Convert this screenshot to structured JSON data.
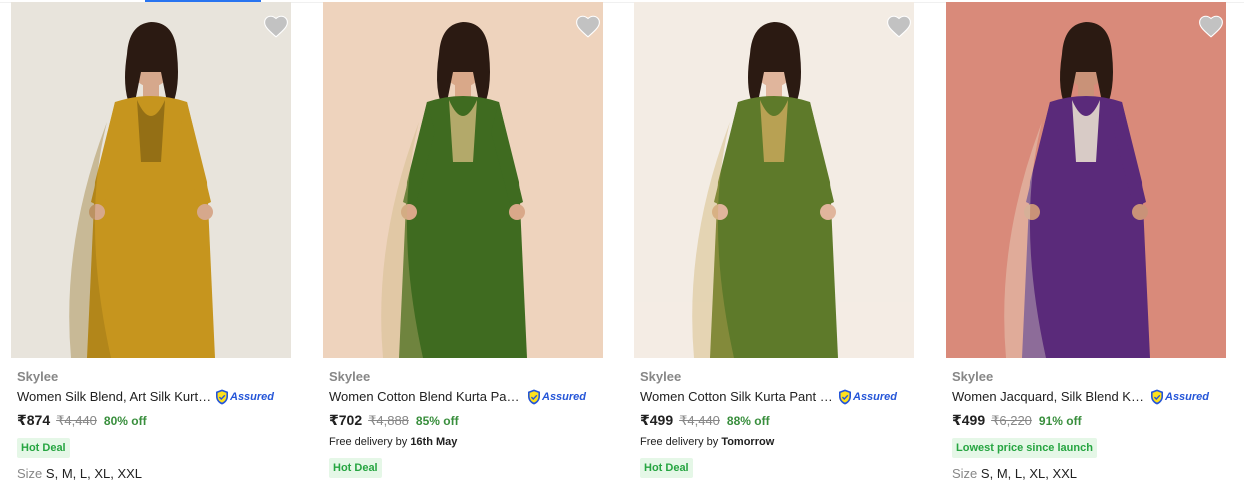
{
  "products": [
    {
      "brand": "Skylee",
      "title": "Women Silk Blend, Art Silk Kurta ...",
      "assured": "Assured",
      "price": "₹874",
      "mrp": "₹4,440",
      "discount": "80% off",
      "delivery_prefix": "",
      "delivery_date": "",
      "badge": "Hot Deal",
      "size_label": "Size",
      "sizes": "S, M, L, XL, XXL",
      "palette": {
        "bg": "#e8e4dc",
        "garment": "#c6951e",
        "accent": "#8b6914",
        "skin": "#d6a88c"
      }
    },
    {
      "brand": "Skylee",
      "title": "Women Cotton Blend Kurta Pant ...",
      "assured": "Assured",
      "price": "₹702",
      "mrp": "₹4,888",
      "discount": "85% off",
      "delivery_prefix": "Free delivery by ",
      "delivery_date": "16th May",
      "badge": "Hot Deal",
      "size_label": "",
      "sizes": "",
      "palette": {
        "bg": "#eed3bd",
        "garment": "#3f6b20",
        "accent": "#c8b478",
        "skin": "#d9a889"
      }
    },
    {
      "brand": "Skylee",
      "title": "Women Cotton Silk Kurta Pant D...",
      "assured": "Assured",
      "price": "₹499",
      "mrp": "₹4,440",
      "discount": "88% off",
      "delivery_prefix": "Free delivery by ",
      "delivery_date": "Tomorrow",
      "badge": "Hot Deal",
      "size_label": "",
      "sizes": "",
      "palette": {
        "bg": "#f3ece4",
        "garment": "#5e7a2a",
        "accent": "#c8a85a",
        "skin": "#e0b59c"
      }
    },
    {
      "brand": "Skylee",
      "title": "Women Jacquard, Silk Blend Kur...",
      "assured": "Assured",
      "price": "₹499",
      "mrp": "₹6,220",
      "discount": "91% off",
      "delivery_prefix": "",
      "delivery_date": "",
      "badge": "Lowest price since launch",
      "size_label": "Size",
      "sizes": "S, M, L, XL, XXL",
      "palette": {
        "bg": "#d98a7a",
        "garment": "#5a2a7a",
        "accent": "#efe8d4",
        "skin": "#c99278"
      }
    }
  ],
  "icons": {
    "wishlist": "heart-icon",
    "assured": "assured-shield-icon"
  },
  "colors": {
    "accent": "#2874f0",
    "price_green": "#388e3c",
    "badge_bg": "#e5f7e7",
    "badge_text": "#26a541",
    "assured_blue": "#2455d8"
  }
}
